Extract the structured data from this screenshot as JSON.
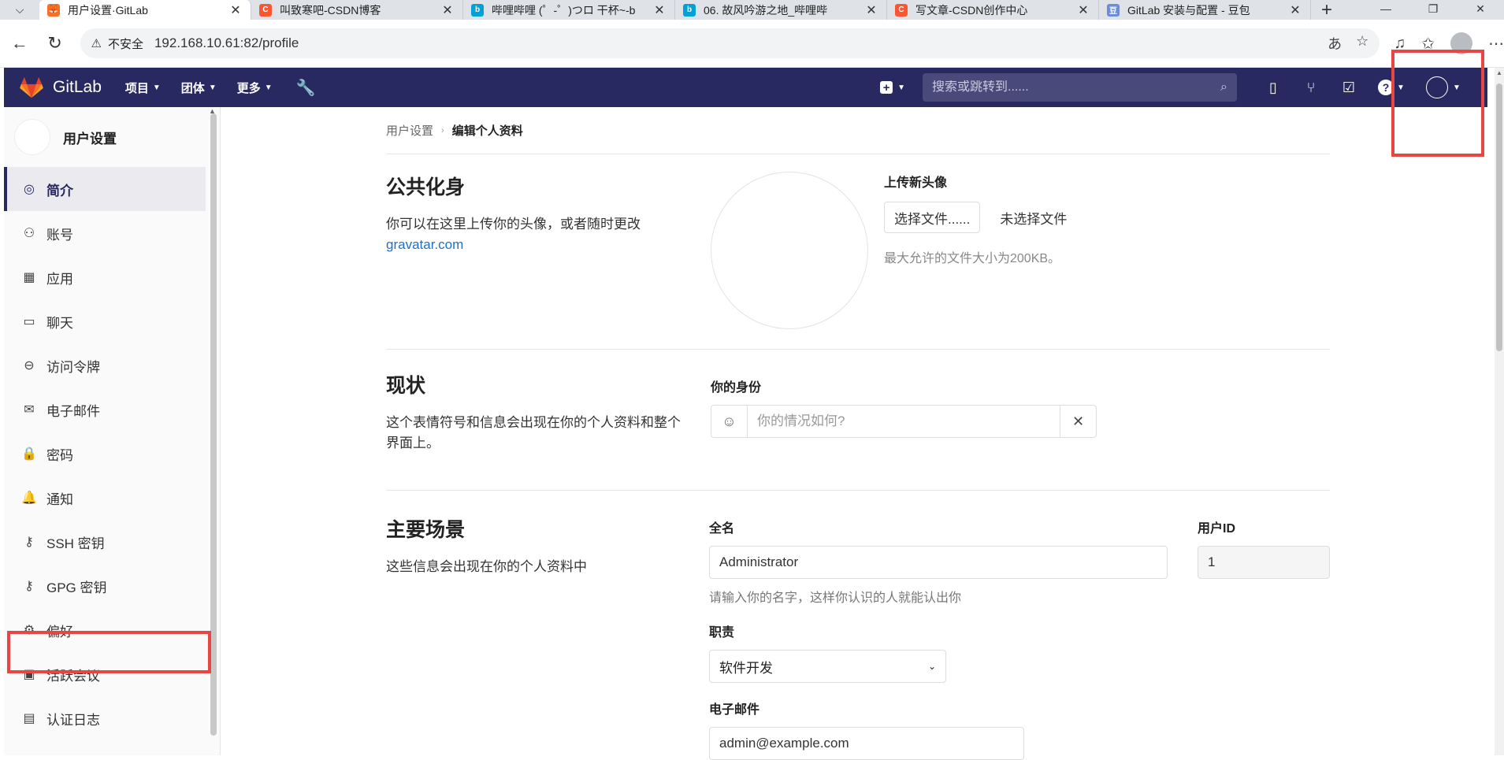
{
  "browser": {
    "tabs": [
      {
        "title": "用户设置·GitLab",
        "active": true,
        "color": "#fc6d26",
        "glyph": "🦊"
      },
      {
        "title": "叫致寒吧-CSDN博客",
        "active": false,
        "color": "#fc5531",
        "glyph": "C"
      },
      {
        "title": "哔哩哔哩 (゜-゜)つロ 干杯~-b",
        "active": false,
        "color": "#00a1d6",
        "glyph": "b"
      },
      {
        "title": "06. 故风吟游之地_哔哩哔",
        "active": false,
        "color": "#00a1d6",
        "glyph": "b"
      },
      {
        "title": "写文章-CSDN创作中心",
        "active": false,
        "color": "#fc5531",
        "glyph": "C"
      },
      {
        "title": "GitLab 安装与配置 - 豆包",
        "active": false,
        "color": "#6c8cd5",
        "glyph": "豆"
      }
    ],
    "insecure_label": "不安全",
    "url": "192.168.10.61:82/profile"
  },
  "navbar": {
    "brand": "GitLab",
    "menu": [
      "项目",
      "团体",
      "更多"
    ],
    "search_placeholder": "搜索或跳转到......"
  },
  "sidebar": {
    "title": "用户设置",
    "items": [
      {
        "label": "简介",
        "icon": "profile-icon",
        "glyph": "◎",
        "active": true
      },
      {
        "label": "账号",
        "icon": "account-icon",
        "glyph": "⚇",
        "active": false
      },
      {
        "label": "应用",
        "icon": "applications-icon",
        "glyph": "▦",
        "active": false
      },
      {
        "label": "聊天",
        "icon": "chat-icon",
        "glyph": "▭",
        "active": false
      },
      {
        "label": "访问令牌",
        "icon": "token-icon",
        "glyph": "⊖",
        "active": false
      },
      {
        "label": "电子邮件",
        "icon": "email-icon",
        "glyph": "✉",
        "active": false
      },
      {
        "label": "密码",
        "icon": "lock-icon",
        "glyph": "🔒",
        "active": false
      },
      {
        "label": "通知",
        "icon": "bell-icon",
        "glyph": "🔔",
        "active": false
      },
      {
        "label": "SSH 密钥",
        "icon": "key-icon",
        "glyph": "⚷",
        "active": false
      },
      {
        "label": "GPG 密钥",
        "icon": "key-icon",
        "glyph": "⚷",
        "active": false
      },
      {
        "label": "偏好",
        "icon": "preferences-icon",
        "glyph": "⚙",
        "active": false
      },
      {
        "label": "活跃会议",
        "icon": "monitor-icon",
        "glyph": "▣",
        "active": false
      },
      {
        "label": "认证日志",
        "icon": "log-icon",
        "glyph": "▤",
        "active": false
      }
    ]
  },
  "breadcrumb": {
    "parent": "用户设置",
    "current": "编辑个人资料"
  },
  "avatar_section": {
    "title": "公共化身",
    "desc": "你可以在这里上传你的头像，或者随时更改",
    "link": "gravatar.com",
    "upload_label": "上传新头像",
    "choose_button": "选择文件......",
    "no_file": "未选择文件",
    "max_size_hint": "最大允许的文件大小为200KB。"
  },
  "status_section": {
    "title": "现状",
    "desc": "这个表情符号和信息会出现在你的个人资料和整个界面上。",
    "field_label": "你的身份",
    "placeholder": "你的情况如何?"
  },
  "main_section": {
    "title": "主要场景",
    "desc": "这些信息会出现在你的个人资料中",
    "fullname_label": "全名",
    "fullname_value": "Administrator",
    "fullname_hint": "请输入你的名字，这样你认识的人就能认出你",
    "userid_label": "用户ID",
    "userid_value": "1",
    "role_label": "职责",
    "role_value": "软件开发",
    "email_label": "电子邮件",
    "email_value": "admin@example.com"
  },
  "colors": {
    "navbar": "#292961",
    "highlight": "#e84545",
    "link": "#1f6fc5"
  }
}
